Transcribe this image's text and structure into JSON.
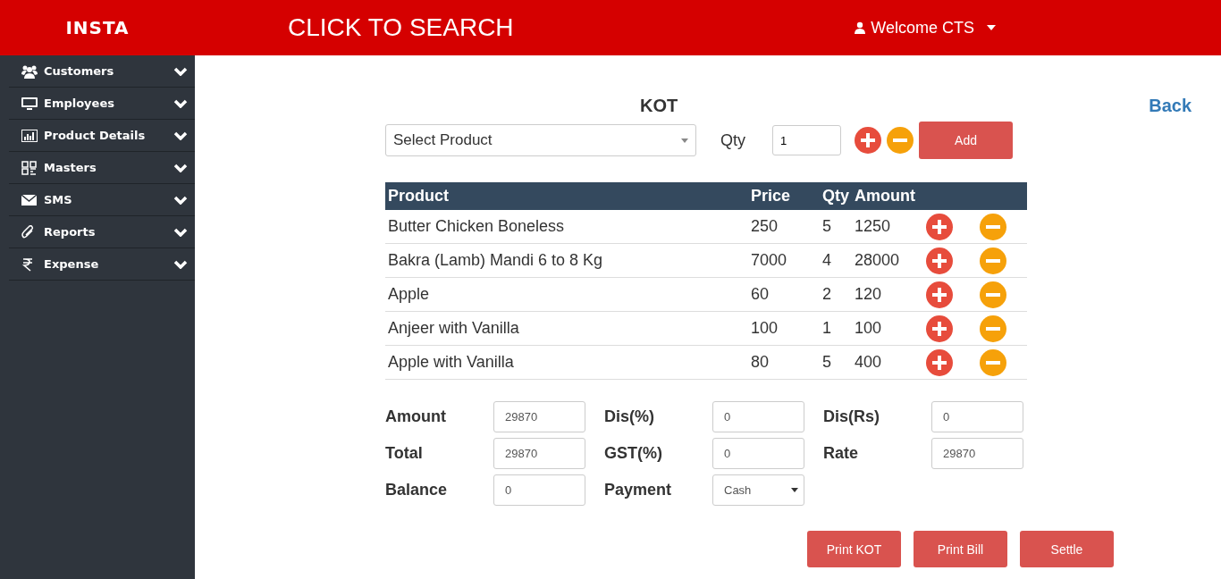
{
  "header": {
    "brand": "INSTA",
    "search": "CLICK TO SEARCH",
    "user": "Welcome CTS"
  },
  "sidebar": {
    "items": [
      {
        "label": "Customers",
        "expanded": false
      },
      {
        "label": "Employees",
        "expanded": false
      },
      {
        "label": "Product Details",
        "expanded": false
      },
      {
        "label": "Masters",
        "expanded": false
      },
      {
        "label": "SMS",
        "expanded": false
      },
      {
        "label": "Reports",
        "expanded": false
      },
      {
        "label": "Expense",
        "expanded": false
      }
    ]
  },
  "page": {
    "title": "KOT",
    "back": "Back"
  },
  "entry": {
    "product_placeholder": "Select Product",
    "qty_label": "Qty",
    "qty_value": "1",
    "add": "Add"
  },
  "table": {
    "columns": [
      "Product",
      "Price",
      "Qty",
      "Amount"
    ],
    "rows": [
      [
        "Butter Chicken Boneless",
        "250",
        "5",
        "1250"
      ],
      [
        "Bakra (Lamb) Mandi 6 to 8 Kg",
        "7000",
        "4",
        "28000"
      ],
      [
        "Apple",
        "60",
        "2",
        "120"
      ],
      [
        "Anjeer with Vanilla",
        "100",
        "1",
        "100"
      ],
      [
        "Apple with Vanilla",
        "80",
        "5",
        "400"
      ]
    ]
  },
  "summary": [
    {
      "label": "Amount",
      "value": "29870",
      "kind": "input"
    },
    {
      "label": "Dis(%)",
      "value": "0",
      "kind": "input"
    },
    {
      "label": "Dis(Rs)",
      "value": "0",
      "kind": "input"
    },
    {
      "label": "Total",
      "value": "29870",
      "kind": "input"
    },
    {
      "label": "GST(%)",
      "value": "0",
      "kind": "input"
    },
    {
      "label": "Rate",
      "value": "29870",
      "kind": "input"
    },
    {
      "label": "Balance",
      "value": "0",
      "kind": "input"
    },
    {
      "label": "Payment",
      "value": "Cash",
      "kind": "select"
    }
  ],
  "buttons": [
    "Print KOT",
    "Print Bill",
    "Settle"
  ]
}
